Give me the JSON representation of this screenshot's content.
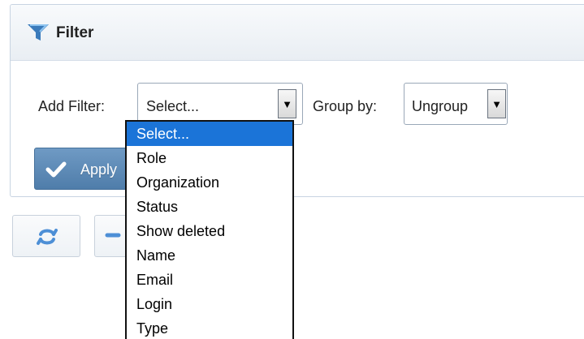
{
  "panel": {
    "title": "Filter",
    "add_filter_label": "Add Filter:",
    "group_by_label": "Group by:",
    "apply_label": "Apply"
  },
  "add_filter_select": {
    "selected": "Select...",
    "arrow": "▼",
    "options": [
      "Select...",
      "Role",
      "Organization",
      "Status",
      "Show deleted",
      "Name",
      "Email",
      "Login",
      "Type"
    ],
    "highlighted_index": 0
  },
  "group_by_select": {
    "selected": "Ungroup",
    "arrow": "▼"
  },
  "icons": {
    "filter": "funnel-icon",
    "apply": "check-icon",
    "refresh": "refresh-icon"
  },
  "colors": {
    "accent": "#5b87b6",
    "selected_option": "#1b74d8",
    "panel_border": "#c8d4e2",
    "icon_blue": "#3b7bbb"
  }
}
